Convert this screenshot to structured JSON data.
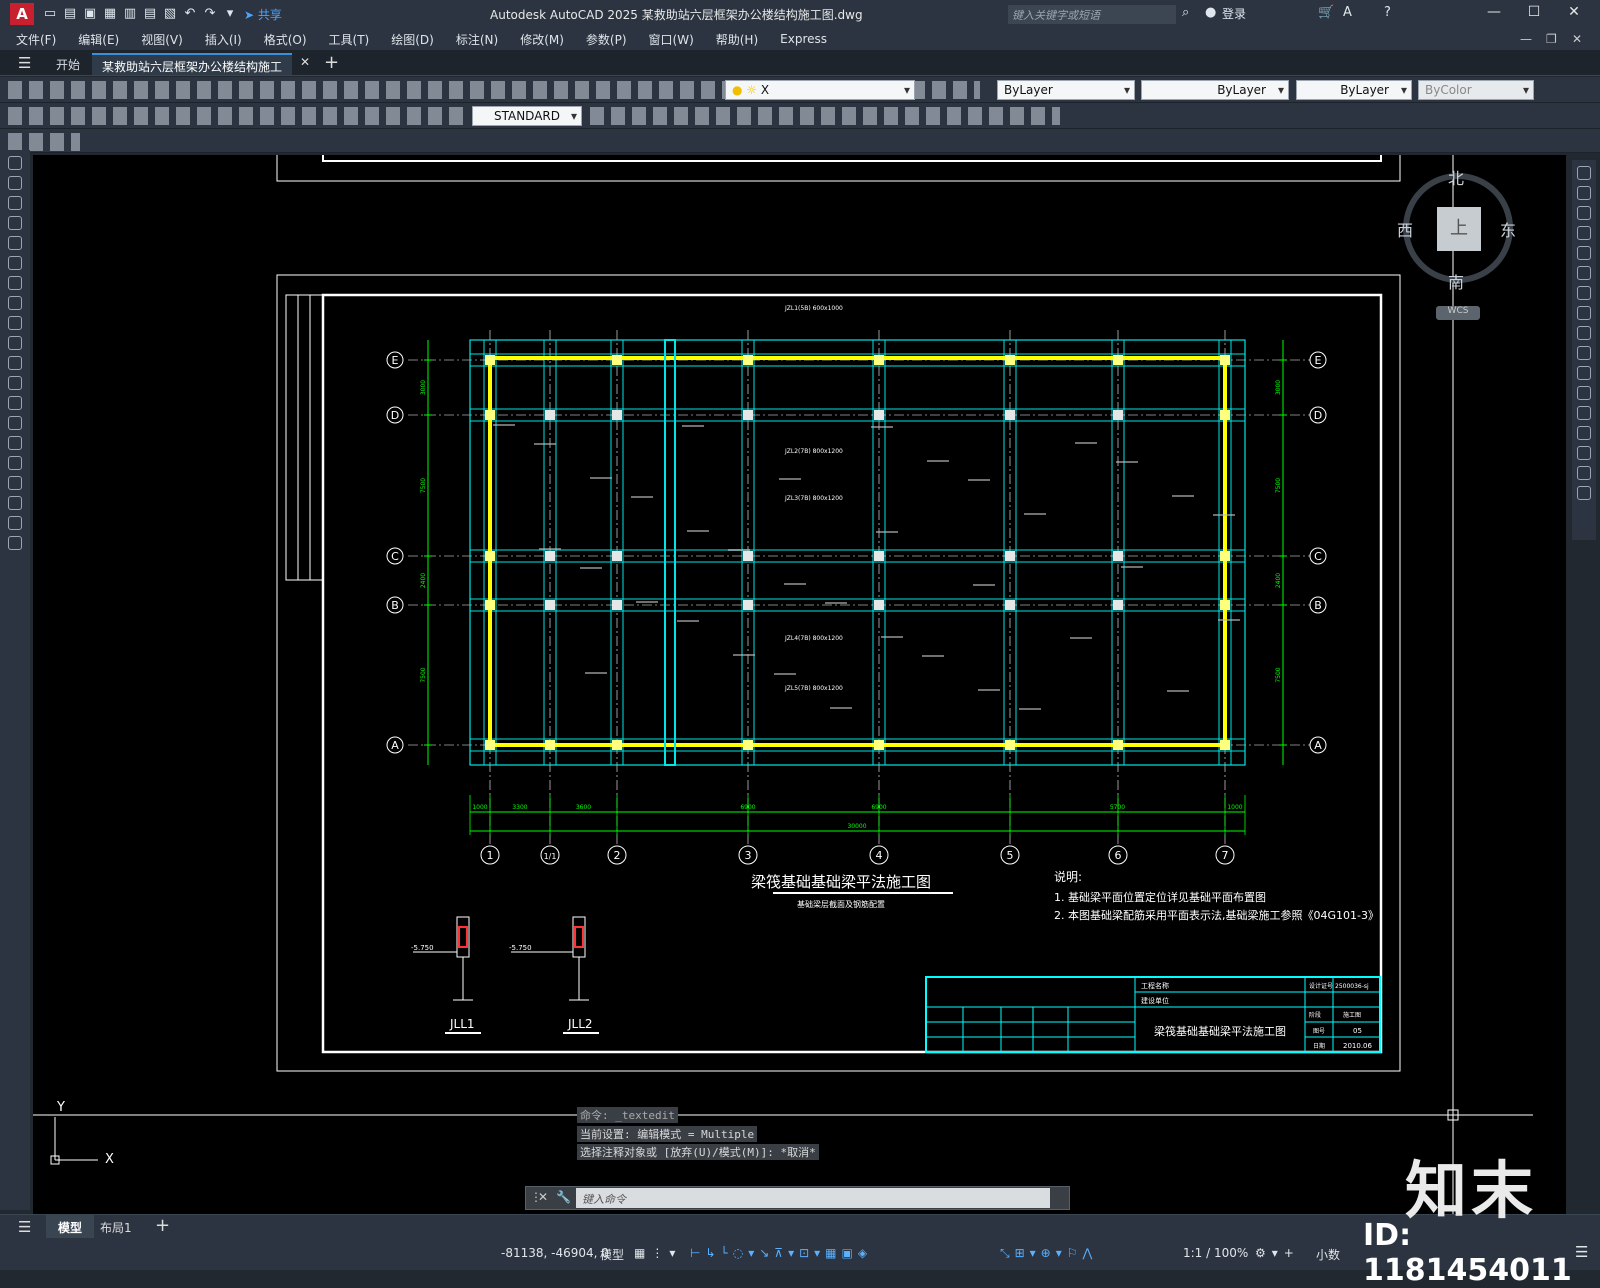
{
  "app": {
    "logo": "A",
    "title": "Autodesk AutoCAD 2025    某救助站六层框架办公楼结构施工图.dwg",
    "share_label": "共享",
    "search_placeholder": "键入关键字或短语",
    "login_label": "登录",
    "help_icon": "?"
  },
  "menu": [
    "文件(F)",
    "编辑(E)",
    "视图(V)",
    "插入(I)",
    "格式(O)",
    "工具(T)",
    "绘图(D)",
    "标注(N)",
    "修改(M)",
    "参数(P)",
    "窗口(W)",
    "帮助(H)",
    "Express"
  ],
  "tabs": {
    "start": "开始",
    "document": "某救助站六层框架办公楼结构施工图*"
  },
  "toolbar": {
    "layer_value": "X",
    "color_value": "ByLayer",
    "linetype_value": "ByLayer",
    "lineweight_value": "ByLayer",
    "plotstyle_value": "ByColor",
    "textstyle_value": "STANDARD"
  },
  "viewcube": {
    "north": "北",
    "south": "南",
    "east": "东",
    "west": "西",
    "top": "上",
    "wcs": "WCS"
  },
  "drawing": {
    "title": "梁筏基础基础梁平法施工图",
    "subtitle": "基础梁层截面及钢筋配置",
    "notes_title": "说明:",
    "notes": [
      "1. 基础梁平面位置定位详见基础平面布置图",
      "2. 本图基础梁配筋采用平面表示法,基础梁施工参照《04G101-3》"
    ],
    "row_axes": [
      "E",
      "D",
      "C",
      "B",
      "A"
    ],
    "col_axes": [
      "1",
      "1/1",
      "2",
      "3",
      "4",
      "5",
      "6",
      "7"
    ],
    "col_dims": [
      "1000",
      "3300",
      "3600",
      "6900",
      "6900",
      "5700",
      "1000"
    ],
    "total_dim": "30000",
    "row_dims": [
      "3000",
      "7500",
      "2400",
      "7500"
    ],
    "beam_labels": [
      "JZL1(5B) 600x1000",
      "JZL2(7B) 800x1200",
      "JZL3(7B) 800x1200",
      "JZL4(7B) 800x1200",
      "JZL5(7B) 800x1200"
    ],
    "section_labels": [
      "JLL1",
      "JLL2"
    ],
    "section_elev": "-5.750",
    "titleblock": {
      "drawing_name": "梁筏基础基础梁平法施工图",
      "project_label": "工程名称",
      "unit_label": "建设单位",
      "sheet_no_label": "图号",
      "sheet_no": "05",
      "date_label": "日期",
      "date": "2010.06",
      "stage_label": "阶段",
      "stage": "施工图",
      "number_label": "设计证号",
      "number": "2500036-sj"
    }
  },
  "command": {
    "history": [
      "命令: _textedit",
      "当前设置: 编辑模式 = Multiple",
      "选择注释对象或 [放弃(U)/模式(M)]: *取消*"
    ],
    "input_placeholder": "键入命令"
  },
  "layout_tabs": [
    "模型",
    "布局1"
  ],
  "status": {
    "coords": "-81138, -46904, 0",
    "space": "模型",
    "scale": "1:1 / 100%",
    "units": "小数"
  },
  "watermark": {
    "logo": "知末",
    "id": "ID: 1181454011"
  },
  "colors": {
    "accent": "#3d8fdb",
    "grid_cyan": "#00e5e5",
    "beam_yellow": "#ffff00",
    "dim_green": "#00ff00"
  }
}
